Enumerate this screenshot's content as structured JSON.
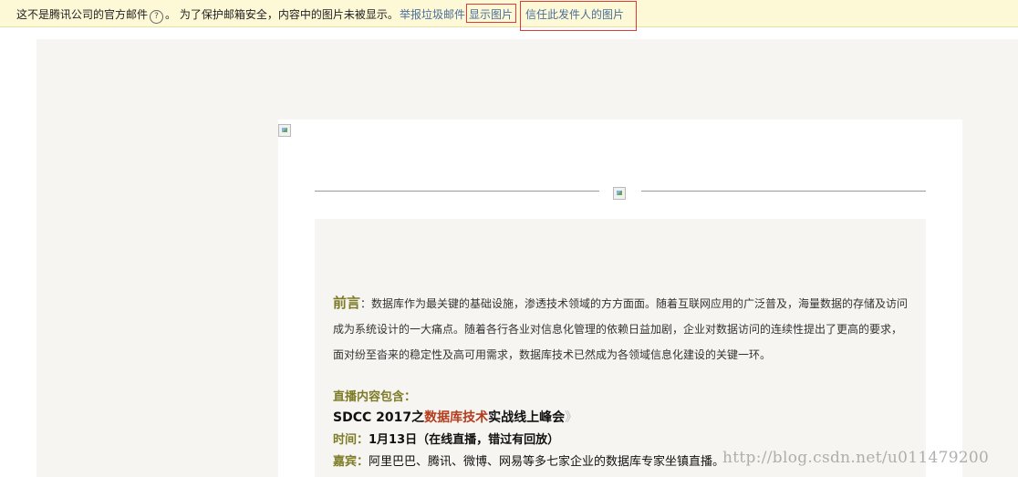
{
  "warning_bar": {
    "message_part1": "这不是腾讯公司的官方邮件",
    "help_icon": "?",
    "message_part2": "。 为了保护邮箱安全，内容中的图片未被显示。",
    "report_spam": "举报垃圾邮件",
    "show_images": "显示图片",
    "trust_sender": "信任此发件人的图片"
  },
  "email": {
    "preface_label": "前言",
    "preface_text": "：数据库作为最关键的基础设施，渗透技术领域的方方面面。随着互联网应用的广泛普及，海量数据的存储及访问成为系统设计的一大痛点。随着各行各业对信息化管理的依赖日益加剧，企业对数据访问的连续性提出了更高的要求，面对纷至沓来的稳定性及高可用需求，数据库技术已然成为各领域信息化建设的关键一环。",
    "section_title": "直播内容包含：",
    "event_prefix": "SDCC 2017之",
    "event_highlight": "数据库技术",
    "event_suffix": "实战线上峰会",
    "event_close_quote": "》",
    "time_label": "时间：",
    "time_value": "1月13日（在线直播，错过有回放）",
    "guests_label": "嘉宾：",
    "guests_value": "阿里巴巴、腾讯、微博、网易等多七家企业的数据库专家坐镇直播。"
  },
  "watermark": "http://blog.csdn.net/u011479200",
  "colors": {
    "accent_olive": "#7d7b25",
    "highlight_red": "#b43d1e",
    "link_blue": "#4a6e9b",
    "warning_bg": "#fdf8d6"
  }
}
